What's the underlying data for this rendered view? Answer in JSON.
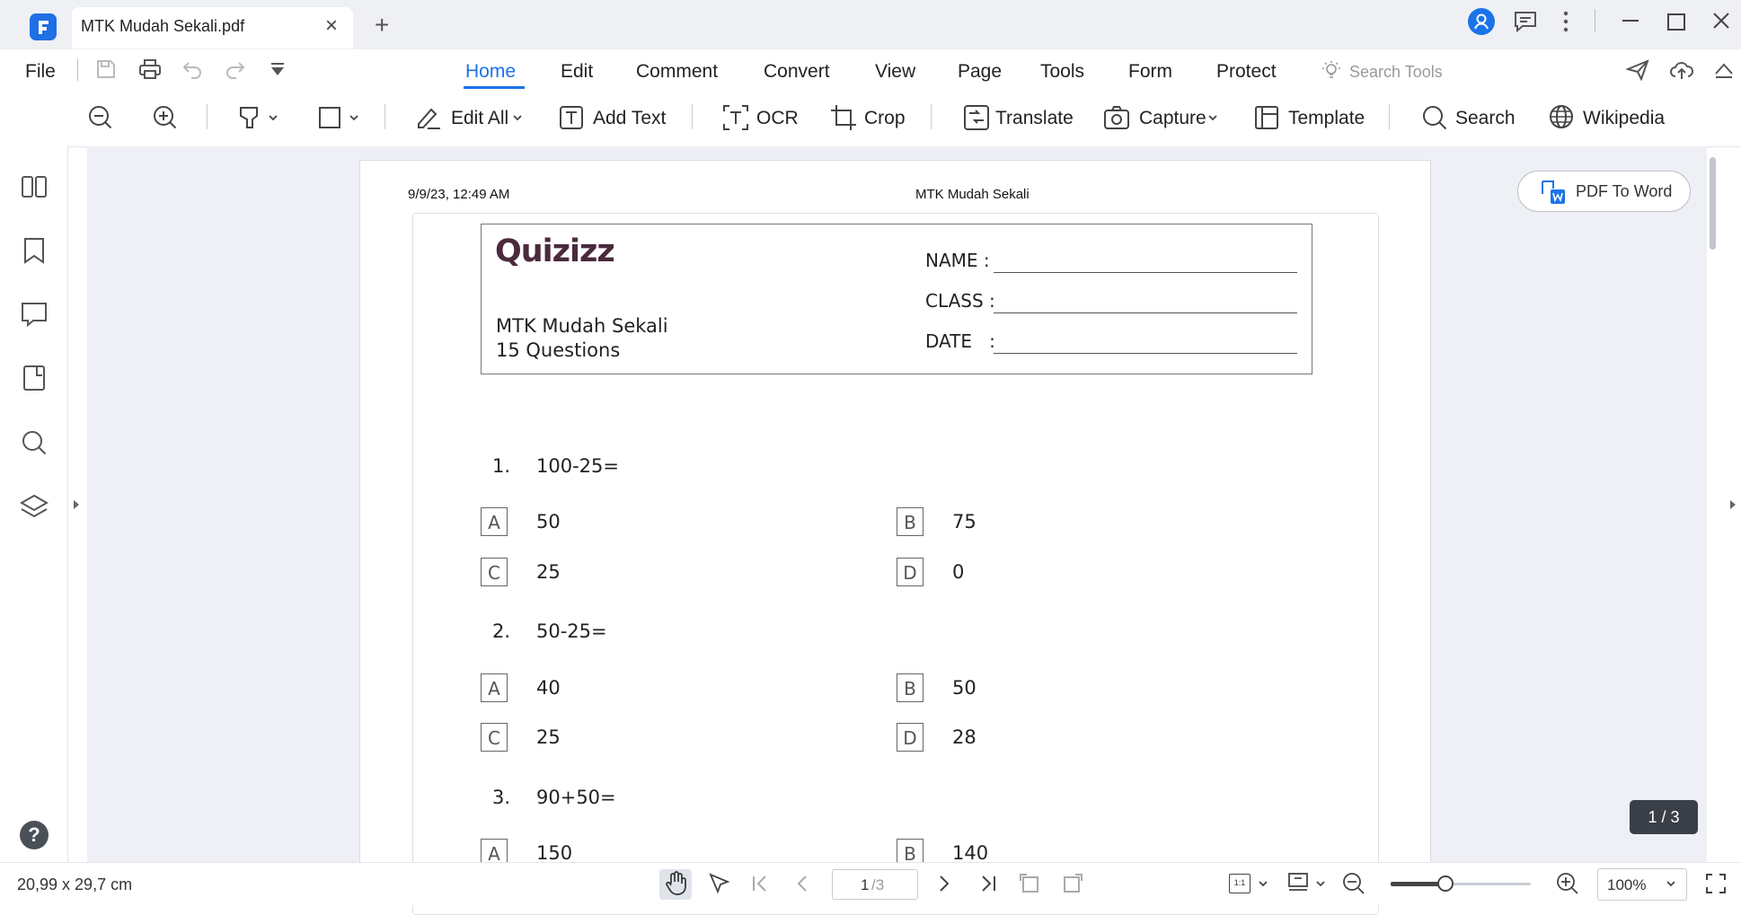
{
  "window": {
    "tab_title": "MTK Mudah Sekali.pdf",
    "new_tab_glyph": "+",
    "close_glyph": "×"
  },
  "menu": {
    "file": "File",
    "tabs": [
      "Home",
      "Edit",
      "Comment",
      "Convert",
      "View",
      "Page",
      "Tools",
      "Form",
      "Protect"
    ],
    "active_tab": "Home",
    "search_tools_placeholder": "Search Tools"
  },
  "ribbon": {
    "edit_all": "Edit All",
    "add_text": "Add Text",
    "ocr": "OCR",
    "crop": "Crop",
    "translate": "Translate",
    "capture": "Capture",
    "template": "Template",
    "search": "Search",
    "wikipedia": "Wikipedia"
  },
  "pdf_to_word": "PDF To Word",
  "document": {
    "print_date": "9/9/23, 12:49 AM",
    "print_title": "MTK Mudah Sekali",
    "logo_text": "Quizizz",
    "quiz_title": "MTK Mudah Sekali",
    "question_count": "15 Questions",
    "name_label": "NAME :",
    "class_label": "CLASS :",
    "date_label": "DATE   :",
    "questions": [
      {
        "num": "1.",
        "text": "100-25=",
        "options": [
          [
            "A",
            "50"
          ],
          [
            "B",
            "75"
          ],
          [
            "C",
            "25"
          ],
          [
            "D",
            "0"
          ]
        ]
      },
      {
        "num": "2.",
        "text": "50-25=",
        "options": [
          [
            "A",
            "40"
          ],
          [
            "B",
            "50"
          ],
          [
            "C",
            "25"
          ],
          [
            "D",
            "28"
          ]
        ]
      },
      {
        "num": "3.",
        "text": "90+50=",
        "options": [
          [
            "A",
            "150"
          ],
          [
            "B",
            "140"
          ]
        ]
      }
    ]
  },
  "page_badge": "1 / 3",
  "status": {
    "dimensions": "20,99 x 29,7 cm",
    "page_current": "1",
    "page_total": "/3",
    "fit_label": "1:1",
    "zoom": "100%",
    "zoom_fraction": 0.39
  },
  "colors": {
    "accent": "#1a73e8",
    "brand": "#1f6fe5",
    "logo": "#4b2a3d",
    "badge": "#3a3f48"
  }
}
